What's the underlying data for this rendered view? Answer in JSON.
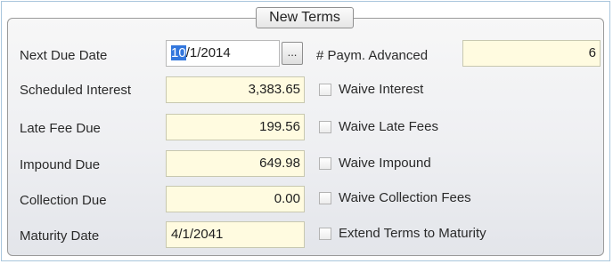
{
  "group": {
    "title": "New Terms"
  },
  "next_due_date": {
    "label": "Next Due Date",
    "value_selected": "10",
    "value_rest": "/1/2014",
    "browse_label": "..."
  },
  "payments_advanced": {
    "label": "# Paym. Advanced",
    "value": "6"
  },
  "scheduled_interest": {
    "label": "Scheduled Interest",
    "value": "3,383.65",
    "checkbox_label": "Waive Interest",
    "checked": false
  },
  "late_fee_due": {
    "label": "Late Fee Due",
    "value": "199.56",
    "checkbox_label": "Waive Late Fees",
    "checked": false
  },
  "impound_due": {
    "label": "Impound Due",
    "value": "649.98",
    "checkbox_label": "Waive Impound",
    "checked": false
  },
  "collection_due": {
    "label": "Collection Due",
    "value": "0.00",
    "checkbox_label": "Waive Collection Fees",
    "checked": false
  },
  "maturity_date": {
    "label": "Maturity Date",
    "value": "4/1/2041",
    "checkbox_label": "Extend Terms to Maturity",
    "checked": false
  }
}
